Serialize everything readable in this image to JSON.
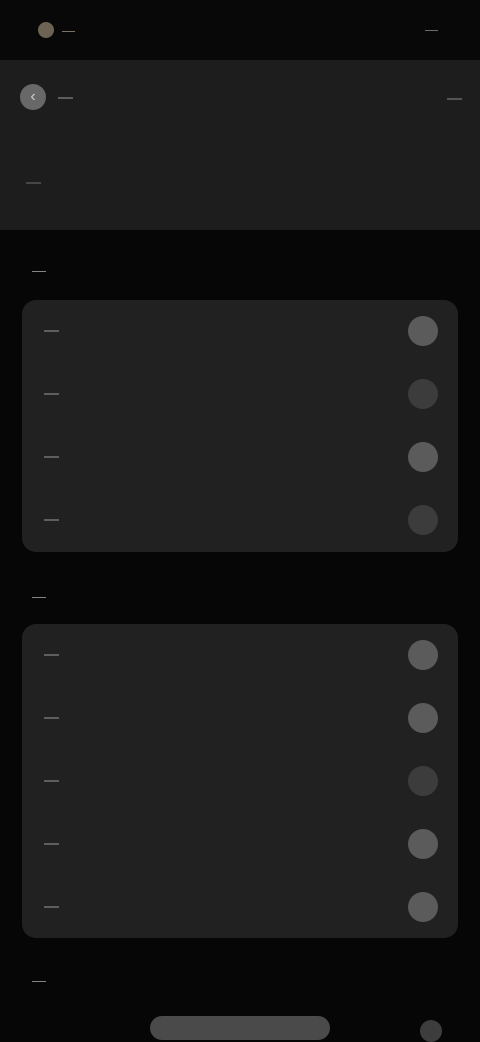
{
  "status": {
    "left_text": "—",
    "right_text": "—"
  },
  "header": {
    "back_label": "—",
    "action_label": "—",
    "subtitle": "—"
  },
  "sections": [
    {
      "title": "—",
      "items": [
        {
          "label": "—"
        },
        {
          "label": "—"
        },
        {
          "label": "—"
        },
        {
          "label": "—"
        }
      ]
    },
    {
      "title": "—",
      "items": [
        {
          "label": "—"
        },
        {
          "label": "—"
        },
        {
          "label": "—"
        },
        {
          "label": "—"
        },
        {
          "label": "—"
        }
      ]
    },
    {
      "title": "—"
    }
  ],
  "icons": {
    "back": "chevron-left-icon",
    "row_control": "toggle-icon"
  },
  "colors": {
    "background": "#060606",
    "header": "#1d1d1d",
    "card": "#212121",
    "toggle": "#5b5b5b"
  }
}
